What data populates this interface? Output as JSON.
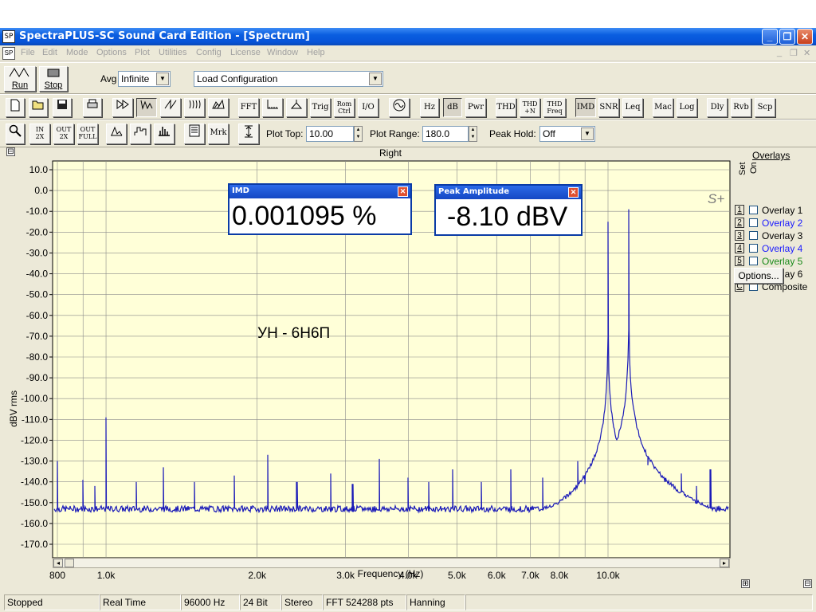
{
  "window": {
    "title": "SpectraPLUS-SC Sound Card Edition - [Spectrum]",
    "minimize": "_",
    "restore": "❐",
    "close": "✕",
    "app_icon": "SP",
    "doc_icon": "SP"
  },
  "menu": {
    "items": [
      "File",
      "Edit",
      "Mode",
      "Options",
      "Plot",
      "Utilities",
      "Config",
      "License",
      "Window",
      "Help"
    ],
    "mdi_min": "_",
    "mdi_restore": "❐",
    "mdi_close": "✕"
  },
  "toolbar1": {
    "run_label": "Run",
    "stop_label": "Stop",
    "avg_label": "Avg",
    "avg_value": "Infinite",
    "config_value": "Load Configuration"
  },
  "toolbar2": {
    "buttons": [
      "FFT",
      "Trig",
      "I/O",
      "Hz",
      "dB",
      "Pwr",
      "THD",
      "IMD",
      "SNR",
      "Leq",
      "Mac",
      "Log",
      "Dly",
      "Rvb",
      "Scp"
    ],
    "rom_ctrl_top": "Rom",
    "rom_ctrl_bottom": "Ctrl",
    "thdn_top": "THD",
    "thdn_bottom": "+N",
    "thdf_top": "THD",
    "thdf_bottom": "Freq"
  },
  "toolbar3": {
    "in_label_top": "IN",
    "in_label_bottom": "2X",
    "out_label_top": "OUT",
    "out_label_bottom": "2X",
    "full_label_top": "OUT",
    "full_label_bottom": "FULL",
    "mrk_label": "Mrk",
    "plot_top_label": "Plot Top:",
    "plot_top_value": "10.00",
    "plot_range_label": "Plot Range:",
    "plot_range_value": "180.0",
    "peak_hold_label": "Peak Hold:",
    "peak_hold_value": "Off"
  },
  "plot": {
    "collapse": "⊟",
    "channel_title": "Right",
    "logo": "S+",
    "annotation": "УН - 6Н6П",
    "expand_bottom_left": "⊞",
    "expand_bottom_right": "⊟",
    "scroll_left": "◂",
    "scroll_right": "▸"
  },
  "imd_readout": {
    "title": "IMD",
    "value": "0.001095 %",
    "close": "✕"
  },
  "peak_readout": {
    "title": "Peak Amplitude",
    "value": "-8.10 dBV",
    "close": "✕"
  },
  "overlays": {
    "title": "Overlays",
    "set_label": "Set",
    "on_label": "On",
    "items": [
      {
        "key": "1",
        "label": "Overlay 1",
        "color": "#000000"
      },
      {
        "key": "2",
        "label": "Overlay 2",
        "color": "#1a1aff"
      },
      {
        "key": "3",
        "label": "Overlay 3",
        "color": "#000000"
      },
      {
        "key": "4",
        "label": "Overlay 4",
        "color": "#1a1aff"
      },
      {
        "key": "5",
        "label": "Overlay 5",
        "color": "#1a8a1a"
      },
      {
        "key": "6",
        "label": "Overlay 6",
        "color": "#000000"
      },
      {
        "key": "C",
        "label": "Composite",
        "color": "#000000"
      }
    ],
    "options_button": "Options..."
  },
  "status": {
    "state": "Stopped",
    "mode": "Real Time",
    "rate": "96000 Hz",
    "bits": "24 Bit",
    "channels": "Stereo",
    "fft": "FFT 524288 pts",
    "window": "Hanning"
  },
  "chart_data": {
    "type": "line",
    "title": "Right",
    "xlabel": "Frequency (Hz)",
    "ylabel": "dBV rms",
    "xscale": "log",
    "xlim": [
      800,
      18000
    ],
    "ylim": [
      -170,
      10
    ],
    "y_ticks": [
      10,
      0,
      -10,
      -20,
      -30,
      -40,
      -50,
      -60,
      -70,
      -80,
      -90,
      -100,
      -110,
      -120,
      -130,
      -140,
      -150,
      -160,
      -170
    ],
    "y_tick_labels": [
      "10.0",
      "0.0",
      "-10.0",
      "-20.0",
      "-30.0",
      "-40.0",
      "-50.0",
      "-60.0",
      "-70.0",
      "-80.0",
      "-90.0",
      "-100.0",
      "-110.0",
      "-120.0",
      "-130.0",
      "-140.0",
      "-150.0",
      "-160.0",
      "-170.0"
    ],
    "x_ticks": [
      800,
      1000,
      2000,
      3000,
      4000,
      5000,
      6000,
      7000,
      8000,
      10000
    ],
    "x_tick_labels": [
      "800",
      "1.0k",
      "2.0k",
      "3.0k",
      "4.0k",
      "5.0k",
      "6.0k",
      "7.0k",
      "8.0k",
      "10.0k"
    ],
    "x_minor_grid": [
      900,
      9000
    ],
    "noise_floor": -153,
    "line_color": "#1a1ab8",
    "background": "#ffffd8",
    "grid": true,
    "peaks": [
      {
        "x": 10000,
        "y": -15
      },
      {
        "x": 11000,
        "y": -9
      },
      {
        "x": 1000,
        "y": -109
      },
      {
        "x": 800,
        "y": -130
      },
      {
        "x": 2100,
        "y": -127
      },
      {
        "x": 3500,
        "y": -129
      },
      {
        "x": 1300,
        "y": -133
      },
      {
        "x": 4900,
        "y": -134
      },
      {
        "x": 8700,
        "y": -130
      },
      {
        "x": 6400,
        "y": -134
      },
      {
        "x": 12000,
        "y": -132
      },
      {
        "x": 1800,
        "y": -137
      },
      {
        "x": 2800,
        "y": -136
      },
      {
        "x": 4000,
        "y": -138
      },
      {
        "x": 7400,
        "y": -138
      },
      {
        "x": 14000,
        "y": -136
      },
      {
        "x": 16000,
        "y": -134
      },
      {
        "x": 900,
        "y": -139
      },
      {
        "x": 950,
        "y": -142
      },
      {
        "x": 1150,
        "y": -140
      },
      {
        "x": 1500,
        "y": -140
      },
      {
        "x": 2400,
        "y": -140
      },
      {
        "x": 3100,
        "y": -141
      },
      {
        "x": 4400,
        "y": -140
      },
      {
        "x": 5600,
        "y": -140
      },
      {
        "x": 9000,
        "y": -141
      },
      {
        "x": 13000,
        "y": -140
      },
      {
        "x": 15000,
        "y": -142
      },
      {
        "x": 17500,
        "y": -146
      }
    ]
  }
}
